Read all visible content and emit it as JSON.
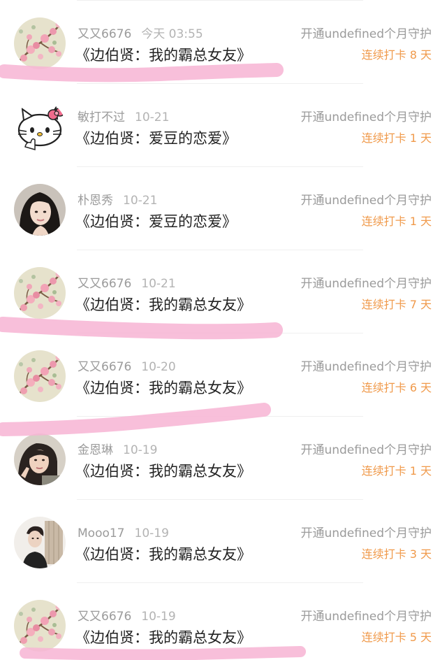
{
  "colors": {
    "name_text": "#9b9b9b",
    "date_text": "#b3b3b3",
    "title_text": "#222222",
    "streak_text": "#f09a4b",
    "redaction": "#f7b4d3"
  },
  "rows": [
    {
      "user": "又又6676",
      "date": "今天 03:55",
      "book": "《边伯贤：我的霸总女友》",
      "action": "开通undefined个月守护",
      "streak": "连续打卡 8 天",
      "avatar_icon": "peach-blossom-avatar-icon"
    },
    {
      "user": "敏打不过",
      "date": "10-21",
      "book": "《边伯贤：爱豆的恋爱》",
      "action": "开通undefined个月守护",
      "streak": "连续打卡 1 天",
      "avatar_icon": "hello-kitty-avatar-icon"
    },
    {
      "user": "朴恩秀",
      "date": "10-21",
      "book": "《边伯贤：爱豆的恋爱》",
      "action": "开通undefined个月守护",
      "streak": "连续打卡 1 天",
      "avatar_icon": "girl-portrait-avatar-icon"
    },
    {
      "user": "又又6676",
      "date": "10-21",
      "book": "《边伯贤：我的霸总女友》",
      "action": "开通undefined个月守护",
      "streak": "连续打卡 7 天",
      "avatar_icon": "peach-blossom-avatar-icon"
    },
    {
      "user": "又又6676",
      "date": "10-20",
      "book": "《边伯贤：我的霸总女友》",
      "action": "开通undefined个月守护",
      "streak": "连续打卡 6 天",
      "avatar_icon": "peach-blossom-avatar-icon"
    },
    {
      "user": "金恩琳",
      "date": "10-19",
      "book": "《边伯贤：我的霸总女友》",
      "action": "开通undefined个月守护",
      "streak": "连续打卡 1 天",
      "avatar_icon": "selfie-girl-avatar-icon"
    },
    {
      "user": "Mooo17",
      "date": "10-19",
      "book": "《边伯贤：我的霸总女友》",
      "action": "开通undefined个月守护",
      "streak": "连续打卡 3 天",
      "avatar_icon": "boy-portrait-avatar-icon"
    },
    {
      "user": "又又6676",
      "date": "10-19",
      "book": "《边伯贤：我的霸总女友》",
      "action": "开通undefined个月守护",
      "streak": "连续打卡 5 天",
      "avatar_icon": "peach-blossom-avatar-icon"
    }
  ]
}
